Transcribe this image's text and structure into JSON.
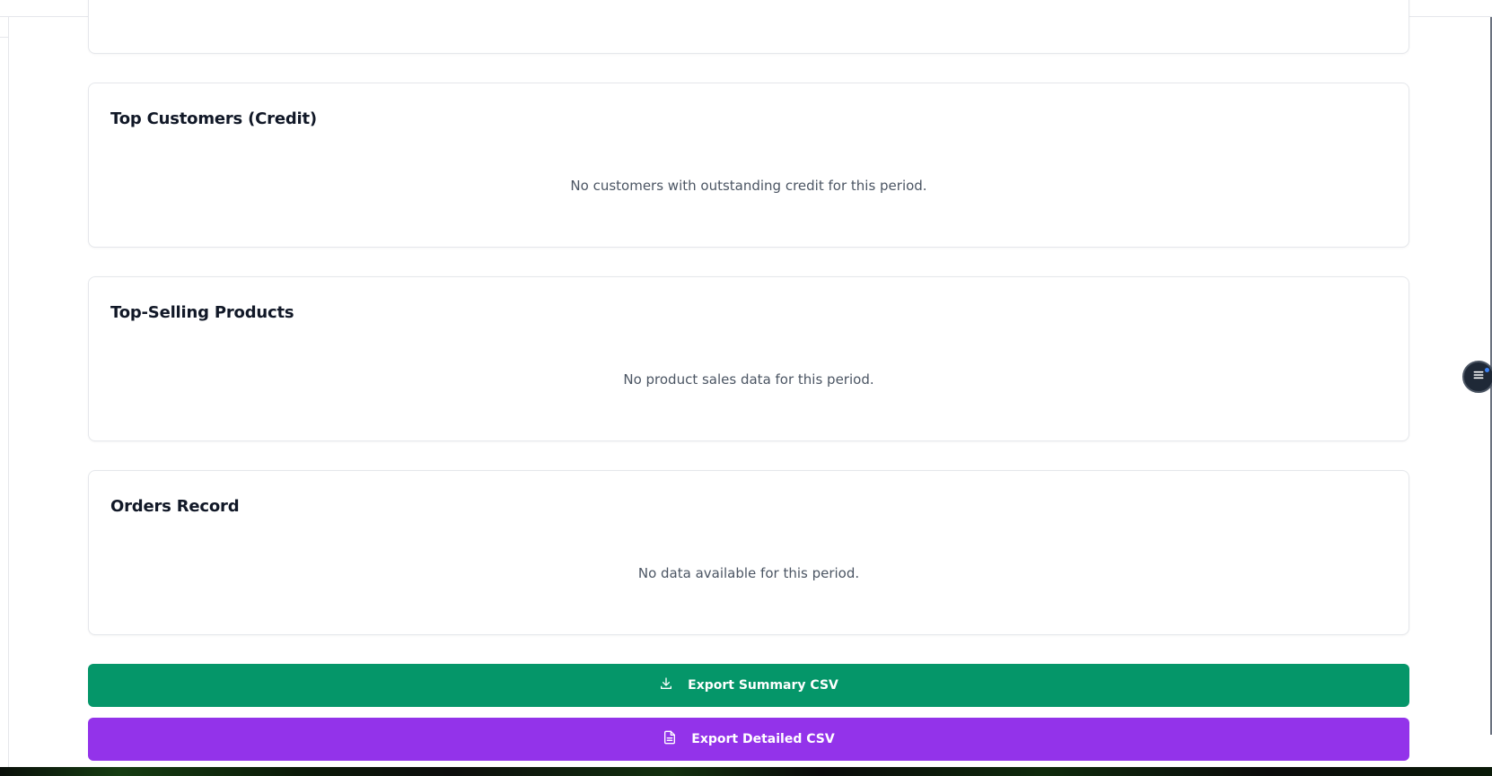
{
  "sections": {
    "top_customers": {
      "title": "Top Customers (Credit)",
      "empty_message": "No customers with outstanding credit for this period."
    },
    "top_products": {
      "title": "Top-Selling Products",
      "empty_message": "No product sales data for this period."
    },
    "orders_record": {
      "title": "Orders Record",
      "empty_message": "No data available for this period."
    }
  },
  "actions": {
    "export_summary_label": "Export Summary CSV",
    "export_detailed_label": "Export Detailed CSV"
  },
  "colors": {
    "export_summary_bg": "#059669",
    "export_detailed_bg": "#9333ea",
    "card_border": "#e5e7eb",
    "muted_text": "#4b5563"
  },
  "icons": {
    "export_summary": "download-icon",
    "export_detailed": "file-text-icon",
    "floating_menu": "menu-icon"
  }
}
